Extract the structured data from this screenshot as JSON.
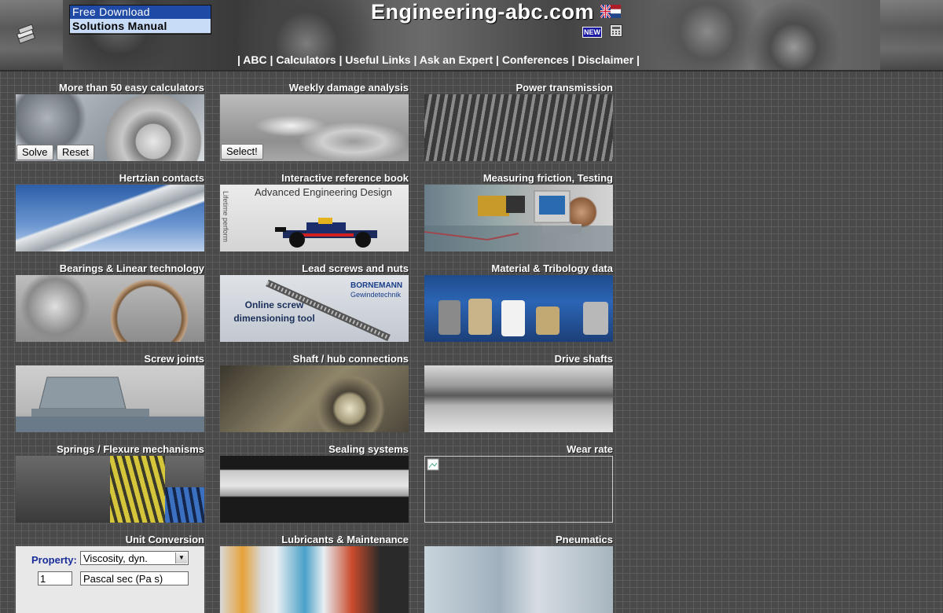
{
  "header": {
    "download": {
      "line1": "Free Download",
      "line2": "Solutions Manual"
    },
    "site_title": "Engineering-abc.com",
    "new_badge": "NEW",
    "nav": {
      "items": [
        "ABC",
        "Calculators",
        "Useful Links",
        "Ask an Expert",
        "Conferences",
        "Disclaimer"
      ],
      "separator": "|"
    }
  },
  "tiles": [
    {
      "title": "More than 50 easy calculators",
      "buttons": [
        "Solve",
        "Reset"
      ]
    },
    {
      "title": "Weekly damage analysis",
      "buttons": [
        "Select!"
      ]
    },
    {
      "title": "Power transmission"
    },
    {
      "title": "Hertzian contacts"
    },
    {
      "title": "Interactive reference book",
      "overlay": "Advanced Engineering Design",
      "overlay_sub": "Lifetime perform"
    },
    {
      "title": "Measuring friction, Testing"
    },
    {
      "title": "Bearings & Linear technology"
    },
    {
      "title": "Lead screws and nuts",
      "overlay": "Online screw dimensioning tool",
      "brand": "BORNEMANN",
      "brand_sub": "Gewindetechnik"
    },
    {
      "title": "Material & Tribology data"
    },
    {
      "title": "Screw joints"
    },
    {
      "title": "Shaft / hub connections"
    },
    {
      "title": "Drive shafts"
    },
    {
      "title": "Springs / Flexure mechanisms"
    },
    {
      "title": "Sealing systems"
    },
    {
      "title": "Wear rate"
    },
    {
      "title": "Unit Conversion",
      "unit_form": {
        "label": "Property:",
        "property": "Viscosity, dyn.",
        "value": "1",
        "unit": "Pascal sec (Pa s)"
      }
    },
    {
      "title": "Lubricants & Maintenance"
    },
    {
      "title": "Pneumatics"
    }
  ]
}
